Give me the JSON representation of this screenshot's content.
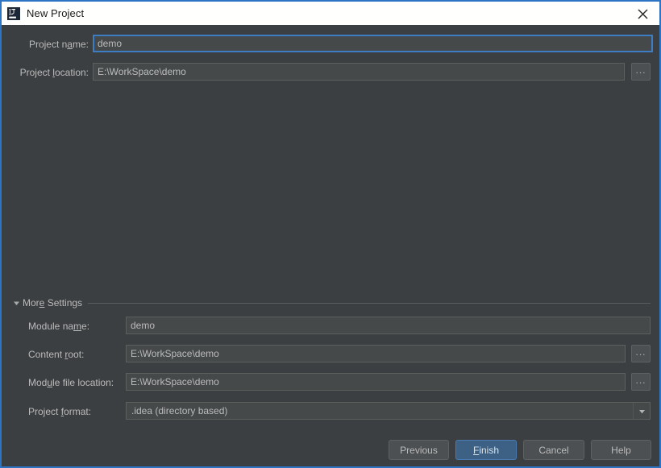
{
  "window": {
    "title": "New Project",
    "icon": "intellij-idea-logo-icon",
    "close_icon": "close-icon",
    "accent_color": "#2d74c4",
    "background_color": "#3c3f41",
    "titlebar_color": "#ffffff"
  },
  "form": {
    "project_name": {
      "label_prefix": "Project n",
      "label_mnemonic": "a",
      "label_suffix": "me:",
      "value": "demo",
      "focused": true
    },
    "project_location": {
      "label_prefix": "Project ",
      "label_mnemonic": "l",
      "label_suffix": "ocation:",
      "value": "E:\\WorkSpace\\demo",
      "browse_label": "...",
      "browse_icon": "ellipsis-browse-icon"
    }
  },
  "more_settings": {
    "label": "More Settings",
    "label_prefix": "Mor",
    "label_mnemonic": "e",
    "label_suffix": " Settings",
    "expanded": true,
    "toggle_icon": "chevron-down-icon"
  },
  "module": {
    "module_name": {
      "label_prefix": "Module na",
      "label_mnemonic": "m",
      "label_suffix": "e:",
      "value": "demo"
    },
    "content_root": {
      "label_prefix": "Content ",
      "label_mnemonic": "r",
      "label_suffix": "oot:",
      "value": "E:\\WorkSpace\\demo",
      "browse_label": "...",
      "browse_icon": "ellipsis-browse-icon"
    },
    "module_file_location": {
      "label_prefix": "Mod",
      "label_mnemonic": "u",
      "label_suffix": "le file location:",
      "value": "E:\\WorkSpace\\demo",
      "browse_label": "...",
      "browse_icon": "ellipsis-browse-icon"
    },
    "project_format": {
      "label_prefix": "Project ",
      "label_mnemonic": "f",
      "label_suffix": "ormat:",
      "value": ".idea (directory based)",
      "dropdown_icon": "chevron-down-icon"
    }
  },
  "buttons": {
    "previous": "Previous",
    "finish_prefix": "",
    "finish_mnemonic": "F",
    "finish_suffix": "inish",
    "cancel": "Cancel",
    "help": "Help",
    "primary_color": "#3d6185"
  }
}
